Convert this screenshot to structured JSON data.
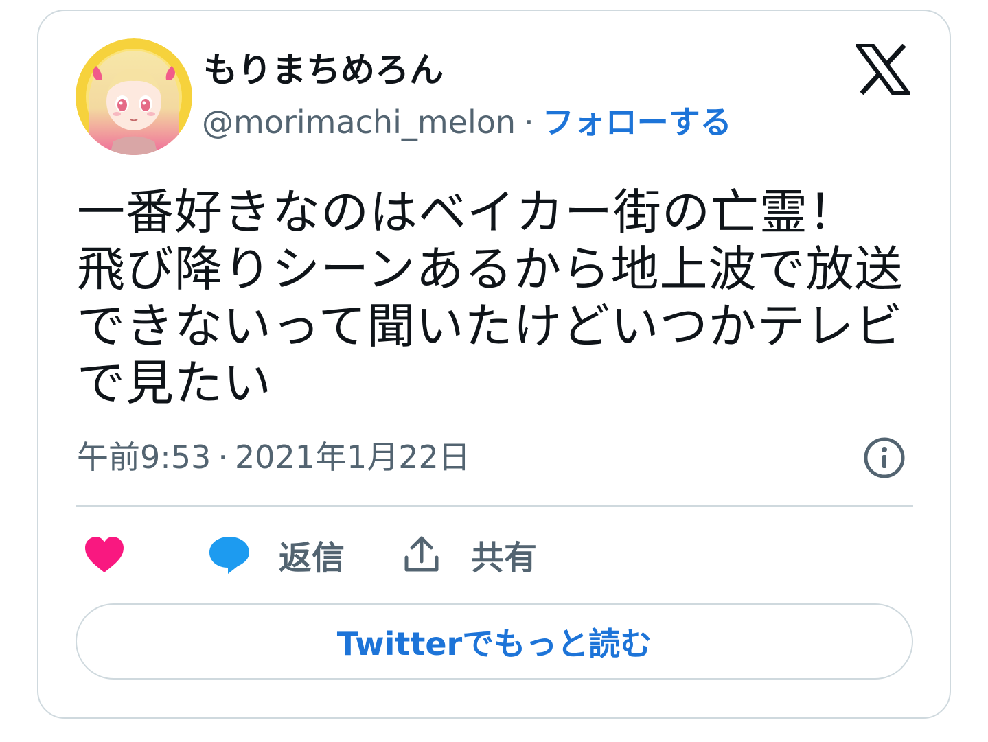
{
  "author": {
    "display_name": "もりまちめろん",
    "handle": "@morimachi_melon",
    "separator": "·",
    "follow_label": "フォローする"
  },
  "tweet": {
    "lines": [
      "一番好きなのはベイカー街の亡霊！",
      "飛び降りシーンあるから地上波で放送",
      "できないって聞いたけどいつかテレビ",
      "で見たい"
    ],
    "time": "午前9:53",
    "separator": "·",
    "date": "2021年1月22日"
  },
  "actions": {
    "reply_label": "返信",
    "share_label": "共有"
  },
  "read_more_label": "Twitterでもっと読む",
  "icons": {
    "brand": "x-logo-icon",
    "info": "info-icon",
    "like": "heart-icon",
    "reply": "speech-bubble-icon",
    "share": "share-upload-icon"
  },
  "colors": {
    "text": "#0f1419",
    "secondary": "#536471",
    "link": "#1d74d8",
    "like": "#f91880",
    "reply": "#1d9bf0",
    "border": "#cfd9de"
  }
}
